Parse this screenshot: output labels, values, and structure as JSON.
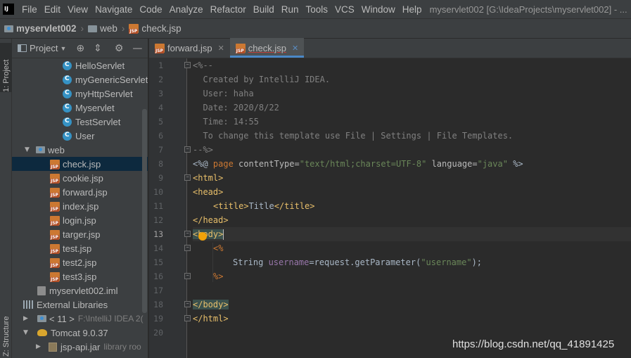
{
  "menubar": {
    "items": [
      "File",
      "Edit",
      "View",
      "Navigate",
      "Code",
      "Analyze",
      "Refactor",
      "Build",
      "Run",
      "Tools",
      "VCS",
      "Window",
      "Help"
    ],
    "window_title": "myservlet002 [G:\\IdeaProjects\\myservlet002] - ..."
  },
  "navbar": {
    "project": "myservlet002",
    "folder": "web",
    "file": "check.jsp"
  },
  "left_tool": {
    "project_tab": "1: Project",
    "structure_tab": "Z: Structure"
  },
  "project_panel": {
    "title": "Project",
    "rows": [
      {
        "label": "HelloServlet"
      },
      {
        "label": "myGenericServlet"
      },
      {
        "label": "myHttpServlet"
      },
      {
        "label": "Myservlet"
      },
      {
        "label": "TestServlet"
      },
      {
        "label": "User"
      },
      {
        "label": "web"
      },
      {
        "label": "check.jsp"
      },
      {
        "label": "cookie.jsp"
      },
      {
        "label": "forward.jsp"
      },
      {
        "label": "index.jsp"
      },
      {
        "label": "login.jsp"
      },
      {
        "label": "targer.jsp"
      },
      {
        "label": "test.jsp"
      },
      {
        "label": "test2.jsp"
      },
      {
        "label": "test3.jsp"
      },
      {
        "label": "myservlet002.iml"
      },
      {
        "label": "External Libraries"
      },
      {
        "label": "< 11 >",
        "hint": "F:\\IntelliJ IDEA 2("
      },
      {
        "label": "Tomcat 9.0.37"
      },
      {
        "label": "jsp-api.jar",
        "hint": "library roo"
      }
    ]
  },
  "editor": {
    "tabs": [
      {
        "label": "forward.jsp"
      },
      {
        "label": "check.jsp"
      }
    ],
    "line_numbers": [
      "1",
      "2",
      "3",
      "4",
      "5",
      "6",
      "7",
      "8",
      "9",
      "10",
      "11",
      "12",
      "13",
      "14",
      "15",
      "16",
      "17",
      "18",
      "19",
      "20"
    ],
    "lines": {
      "l1": "<%--",
      "l2": "  Created by IntelliJ IDEA.",
      "l3": "  User: haha",
      "l4": "  Date: 2020/8/22",
      "l5": "  Time: 14:55",
      "l6": "  To change this template use File | Settings | File Templates.",
      "l7": "--%>",
      "l8_open": "<%@ ",
      "l8_page": "page ",
      "l8_attr1": "contentType=",
      "l8_val1": "\"text/html;charset=UTF-8\"",
      "l8_attr2": " language=",
      "l8_val2": "\"java\"",
      "l8_close": " %>",
      "l9": "<html>",
      "l10": "<head>",
      "l11_open": "<title>",
      "l11_text": "Title",
      "l11_close": "</title>",
      "l12": "</head>",
      "l13": "<body>",
      "l14": "<%",
      "l15_type": "String ",
      "l15_var": "username",
      "l15_rest": "=request.getParameter(",
      "l15_str": "\"username\"",
      "l15_end": ");",
      "l16": "%>",
      "l18": "</body>",
      "l19": "</html>"
    }
  },
  "watermark": "https://blog.csdn.net/qq_41891425"
}
